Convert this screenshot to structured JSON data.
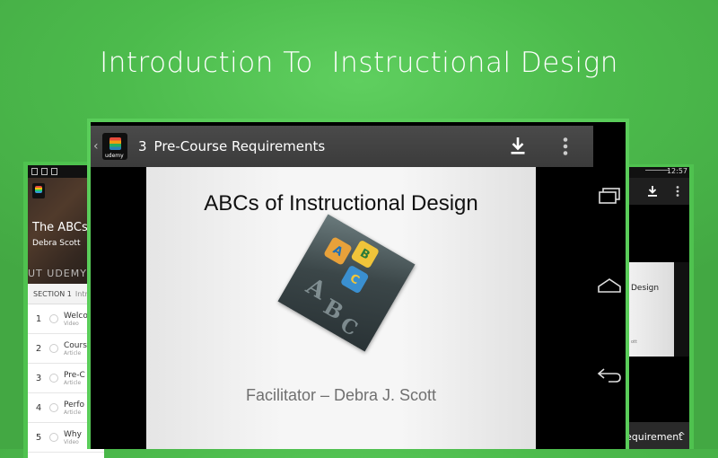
{
  "headline": "Introduction To  Instructional Design",
  "left_device": {
    "course_title": "The ABCs of",
    "instructor": "Debra Scott",
    "about_label": "UT UDEMY",
    "section_label": "SECTION 1",
    "section_title": "Intro",
    "lectures": [
      {
        "num": "1",
        "title": "Welco",
        "type": "Video"
      },
      {
        "num": "2",
        "title": "Cours",
        "type": "Article"
      },
      {
        "num": "3",
        "title": "Pre-C",
        "type": "Article"
      },
      {
        "num": "4",
        "title": "Perfo",
        "type": "Article"
      },
      {
        "num": "5",
        "title": "Why",
        "type": "Video"
      }
    ]
  },
  "center_device": {
    "app_name": "udemy",
    "lecture_number": "3",
    "lecture_title": "Pre-Course Requirements",
    "icons": {
      "back": "chevron-left-icon",
      "download": "download-icon",
      "overflow": "overflow-menu-icon",
      "recents": "recent-apps-icon",
      "home": "home-icon",
      "nav_back": "back-arrow-icon"
    },
    "slide": {
      "title": "ABCs of Instructional Design",
      "facilitator": "Facilitator – Debra J. Scott",
      "blocks": [
        "A",
        "B",
        "C"
      ]
    }
  },
  "right_device": {
    "clock": "12:57",
    "slide_fragment": "Design",
    "slide_fragment_sub": "ott",
    "bottom_title": "equirement",
    "chevron": "^"
  },
  "colors": {
    "background_green": "#4cbb4c",
    "frame_green": "#5acd5a",
    "action_bar": "#434343",
    "slide_bg": "#f2f2f2"
  }
}
